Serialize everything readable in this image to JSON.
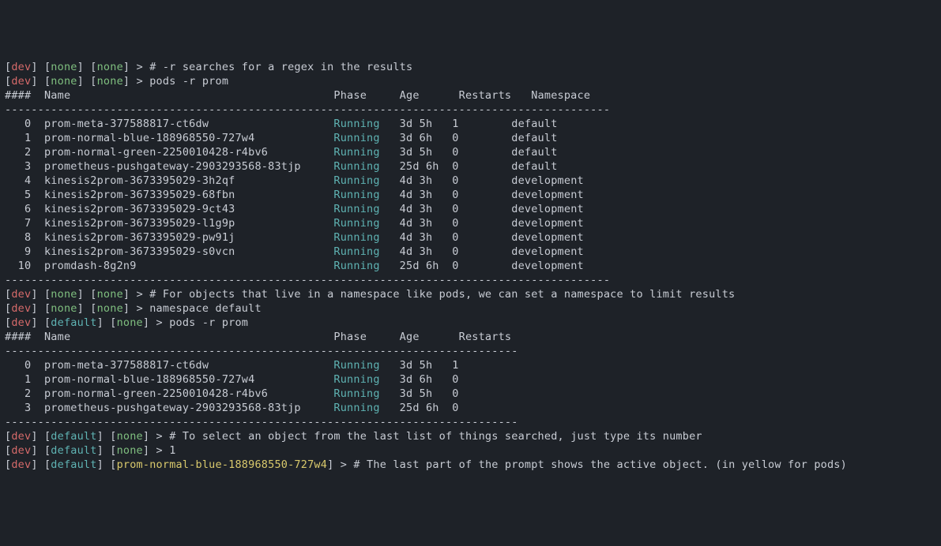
{
  "prompts": {
    "dev": "dev",
    "none": "none",
    "default": "default"
  },
  "lines": [
    {
      "type": "prompt",
      "ctx": "dev",
      "ns": "none",
      "obj": "none",
      "objcolor": "green",
      "cmd": "# -r searches for a regex in the results"
    },
    {
      "type": "prompt",
      "ctx": "dev",
      "ns": "none",
      "obj": "none",
      "objcolor": "green",
      "cmd": "pods -r prom"
    },
    {
      "type": "header",
      "cols": [
        "####",
        "Name",
        "Phase",
        "Age",
        "Restarts",
        "Namespace"
      ],
      "widths": [
        6,
        44,
        10,
        9,
        11,
        12
      ]
    },
    {
      "type": "divider",
      "len": 92
    },
    {
      "type": "row",
      "idx": "0",
      "name": "prom-meta-377588817-ct6dw",
      "phase": "Running",
      "age": "3d 5h",
      "restarts": "1",
      "ns": "default"
    },
    {
      "type": "row",
      "idx": "1",
      "name": "prom-normal-blue-188968550-727w4",
      "phase": "Running",
      "age": "3d 6h",
      "restarts": "0",
      "ns": "default"
    },
    {
      "type": "row",
      "idx": "2",
      "name": "prom-normal-green-2250010428-r4bv6",
      "phase": "Running",
      "age": "3d 5h",
      "restarts": "0",
      "ns": "default"
    },
    {
      "type": "row",
      "idx": "3",
      "name": "prometheus-pushgateway-2903293568-83tjp",
      "phase": "Running",
      "age": "25d 6h",
      "restarts": "0",
      "ns": "default"
    },
    {
      "type": "row",
      "idx": "4",
      "name": "kinesis2prom-3673395029-3h2qf",
      "phase": "Running",
      "age": "4d 3h",
      "restarts": "0",
      "ns": "development"
    },
    {
      "type": "row",
      "idx": "5",
      "name": "kinesis2prom-3673395029-68fbn",
      "phase": "Running",
      "age": "4d 3h",
      "restarts": "0",
      "ns": "development"
    },
    {
      "type": "row",
      "idx": "6",
      "name": "kinesis2prom-3673395029-9ct43",
      "phase": "Running",
      "age": "4d 3h",
      "restarts": "0",
      "ns": "development"
    },
    {
      "type": "row",
      "idx": "7",
      "name": "kinesis2prom-3673395029-l1g9p",
      "phase": "Running",
      "age": "4d 3h",
      "restarts": "0",
      "ns": "development"
    },
    {
      "type": "row",
      "idx": "8",
      "name": "kinesis2prom-3673395029-pw91j",
      "phase": "Running",
      "age": "4d 3h",
      "restarts": "0",
      "ns": "development"
    },
    {
      "type": "row",
      "idx": "9",
      "name": "kinesis2prom-3673395029-s0vcn",
      "phase": "Running",
      "age": "4d 3h",
      "restarts": "0",
      "ns": "development"
    },
    {
      "type": "row",
      "idx": "10",
      "name": "promdash-8g2n9",
      "phase": "Running",
      "age": "25d 6h",
      "restarts": "0",
      "ns": "development"
    },
    {
      "type": "divider",
      "len": 92
    },
    {
      "type": "prompt",
      "ctx": "dev",
      "ns": "none",
      "obj": "none",
      "objcolor": "green",
      "cmd": "# For objects that live in a namespace like pods, we can set a namespace to limit results"
    },
    {
      "type": "prompt",
      "ctx": "dev",
      "ns": "none",
      "obj": "none",
      "objcolor": "green",
      "cmd": "namespace default"
    },
    {
      "type": "prompt",
      "ctx": "dev",
      "ns": "default",
      "obj": "none",
      "objcolor": "green",
      "cmd": "pods -r prom"
    },
    {
      "type": "header",
      "cols": [
        "####",
        "Name",
        "Phase",
        "Age",
        "Restarts"
      ],
      "widths": [
        6,
        44,
        10,
        9,
        9
      ]
    },
    {
      "type": "divider",
      "len": 78
    },
    {
      "type": "row",
      "idx": "0",
      "name": "prom-meta-377588817-ct6dw",
      "phase": "Running",
      "age": "3d 5h",
      "restarts": "1"
    },
    {
      "type": "row",
      "idx": "1",
      "name": "prom-normal-blue-188968550-727w4",
      "phase": "Running",
      "age": "3d 6h",
      "restarts": "0"
    },
    {
      "type": "row",
      "idx": "2",
      "name": "prom-normal-green-2250010428-r4bv6",
      "phase": "Running",
      "age": "3d 5h",
      "restarts": "0"
    },
    {
      "type": "row",
      "idx": "3",
      "name": "prometheus-pushgateway-2903293568-83tjp",
      "phase": "Running",
      "age": "25d 6h",
      "restarts": "0"
    },
    {
      "type": "divider",
      "len": 78
    },
    {
      "type": "prompt",
      "ctx": "dev",
      "ns": "default",
      "obj": "none",
      "objcolor": "green",
      "cmd": "# To select an object from the last list of things searched, just type its number"
    },
    {
      "type": "prompt",
      "ctx": "dev",
      "ns": "default",
      "obj": "none",
      "objcolor": "green",
      "cmd": "1"
    },
    {
      "type": "prompt",
      "ctx": "dev",
      "ns": "default",
      "obj": "prom-normal-blue-188968550-727w4",
      "objcolor": "yellow",
      "cmd": "# The last part of the prompt shows the active object. (in yellow for pods)"
    }
  ]
}
